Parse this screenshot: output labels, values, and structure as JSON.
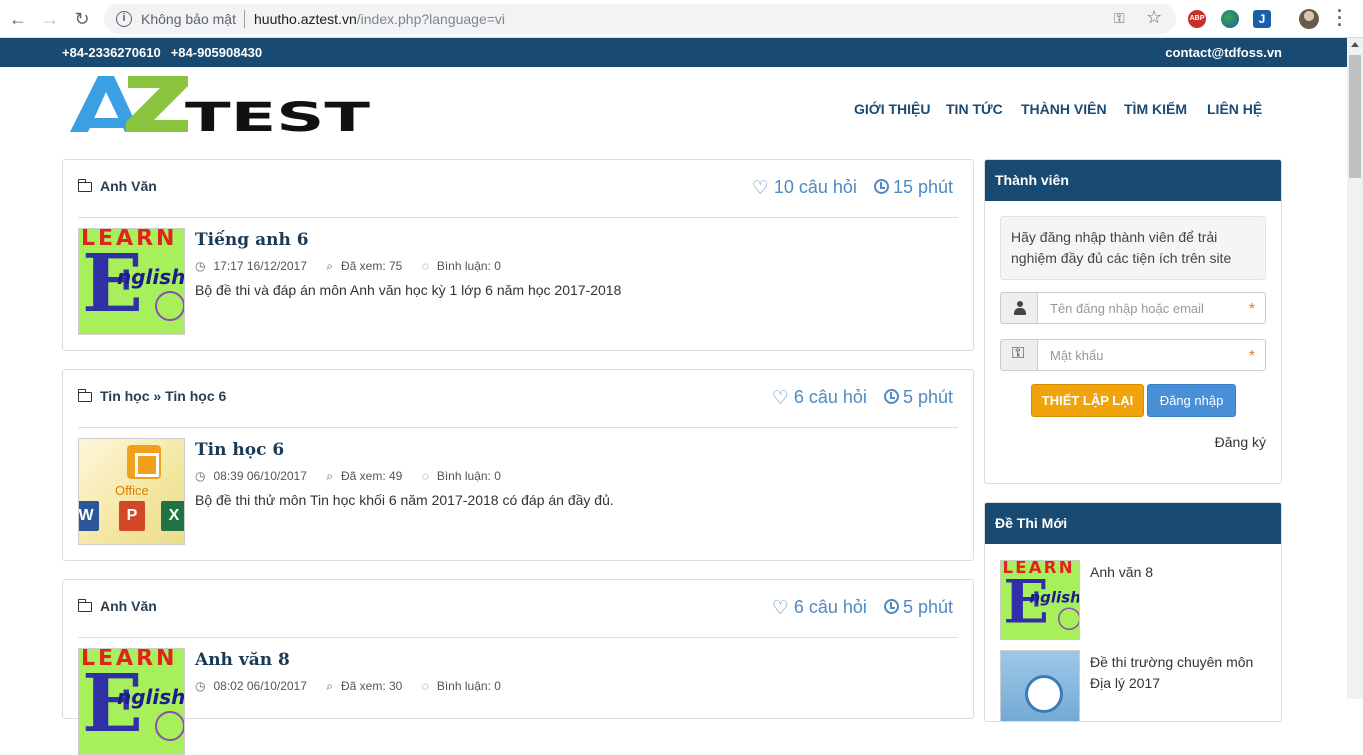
{
  "browser": {
    "security_label": "Không bảo mật",
    "url_host": "huutho.aztest.vn",
    "url_path": "/index.php?language=vi",
    "abp_label": "ABP"
  },
  "topbar": {
    "phone1": "+84-2336270610",
    "phone2": "+84-905908430",
    "email": "contact@tdfoss.vn"
  },
  "logo": {
    "text": "AZTEST"
  },
  "nav": [
    "GIỚI THIỆU",
    "TIN TỨC",
    "THÀNH VIÊN",
    "TÌM KIẾM",
    "LIÊN HỆ"
  ],
  "cards": [
    {
      "category": "Anh Văn",
      "questions": "10 câu hỏi",
      "duration": "15 phút",
      "title": "Tiếng anh 6",
      "time": "17:17 16/12/2017",
      "views": "Đã xem: 75",
      "comments": "Bình luận: 0",
      "description": "Bộ đề thi và đáp án môn Anh văn học kỳ 1 lớp 6 năm học 2017-2018"
    },
    {
      "category": "Tin học » Tin học 6",
      "questions": "6 câu hỏi",
      "duration": "5 phút",
      "title": "Tin học 6",
      "time": "08:39 06/10/2017",
      "views": "Đã xem: 49",
      "comments": "Bình luận: 0",
      "description": "Bộ đề thi thử môn Tin học khối 6 năm 2017-2018 có đáp án đầy đủ."
    },
    {
      "category": "Anh Văn",
      "questions": "6 câu hỏi",
      "duration": "5 phút",
      "title": "Anh văn 8",
      "time": "08:02 06/10/2017",
      "views": "Đã xem: 30",
      "comments": "Bình luận: 0",
      "description": ""
    }
  ],
  "thumbs": {
    "learn": "LEARN",
    "english": "nglish",
    "office_label": "Office",
    "office_tiles": [
      "W",
      "P",
      "X"
    ]
  },
  "member_panel": {
    "title": "Thành viên",
    "notice": "Hãy đăng nhập thành viên để trải nghiệm đầy đủ các tiện ích trên site",
    "username_placeholder": "Tên đăng nhập hoặc email",
    "password_placeholder": "Mật khẩu",
    "required_mark": "*",
    "reset_label": "THIẾT LẬP LẠI",
    "login_label": "Đăng nhập",
    "register_label": "Đăng ký"
  },
  "new_exams": {
    "title": "Đề Thi Mới",
    "items": [
      {
        "title": "Anh văn 8"
      },
      {
        "title": "Đề thi trường chuyên môn Địa lý 2017"
      }
    ]
  },
  "colors": {
    "primary": "#194a72",
    "accent": "#4e8ac3",
    "warning": "#f0a30a",
    "button_blue": "#4a90d9"
  }
}
